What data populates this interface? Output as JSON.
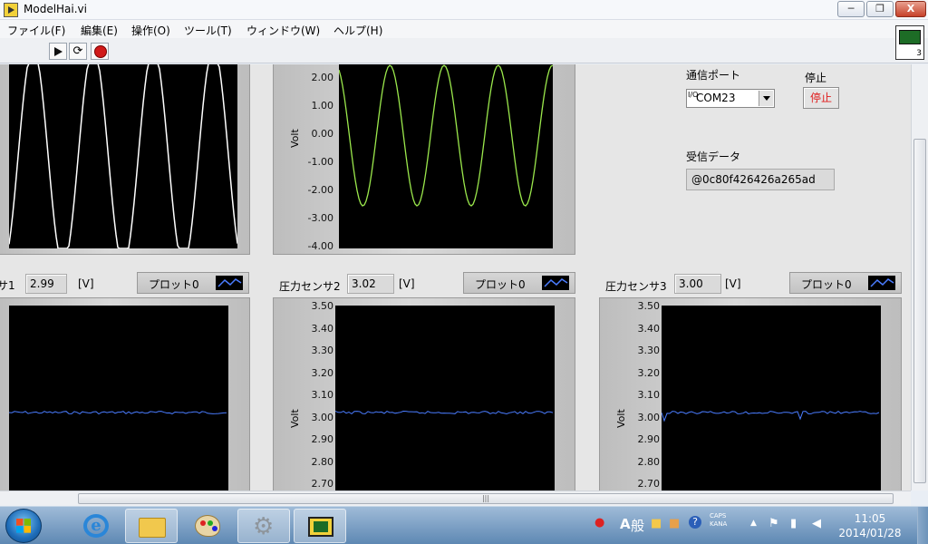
{
  "window": {
    "title": "ModelHai.vi",
    "minimize_glyph": "─",
    "maximize_glyph": "❐",
    "close_glyph": "X"
  },
  "menu": [
    "ファイル(F)",
    "編集(E)",
    "操作(O)",
    "ツール(T)",
    "ウィンドウ(W)",
    "ヘルプ(H)"
  ],
  "toolbar": {
    "run": "run-arrow-icon",
    "continuous": "continuous-run-icon",
    "abort": "abort-icon",
    "continuous_glyph": "⟳",
    "vi_icon_label": "3"
  },
  "controls": {
    "com_label": "通信ポート",
    "com_io_glyph": "I/O",
    "com_value": "COM23",
    "stop_label": "停止",
    "stop_button": "停止",
    "recv_label": "受信データ",
    "recv_value": "@0c80f426426a265ad"
  },
  "top_graph": {
    "ylabel": "Volt",
    "ticks": [
      "2.00",
      "1.00",
      "0.00",
      "-1.00",
      "-2.00",
      "-3.00",
      "-4.00"
    ],
    "trace_color": "#9be84c"
  },
  "left_graph": {
    "trace_color": "#ffffff"
  },
  "sensors": [
    {
      "label": "サ1",
      "value": "2.99",
      "unit": "[V]",
      "legend": "プロット0"
    },
    {
      "label": "圧力センサ2",
      "value": "3.02",
      "unit": "[V]",
      "legend": "プロット0",
      "ylabel": "Volt",
      "ticks": [
        "3.50",
        "3.40",
        "3.30",
        "3.20",
        "3.10",
        "3.00",
        "2.90",
        "2.80",
        "2.70"
      ]
    },
    {
      "label": "圧力センサ3",
      "value": "3.00",
      "unit": "[V]",
      "legend": "プロット0",
      "ylabel": "Volt",
      "ticks": [
        "3.50",
        "3.40",
        "3.30",
        "3.20",
        "3.10",
        "3.00",
        "2.90",
        "2.80",
        "2.70"
      ]
    }
  ],
  "sensor_trace_color": "#4a7cff",
  "hscroll_grip": "|||",
  "taskbar": {
    "apps": [
      "internet-explorer",
      "file-explorer",
      "paint",
      "settings",
      "labview"
    ],
    "ie_glyph": "e",
    "gear_glyph": "⚙",
    "ime_a": "A",
    "ime_mode": "般",
    "caps": "CAPS",
    "kana": "KANA",
    "tray_up_glyph": "▲",
    "time": "11:05",
    "date": "2014/01/28"
  }
}
